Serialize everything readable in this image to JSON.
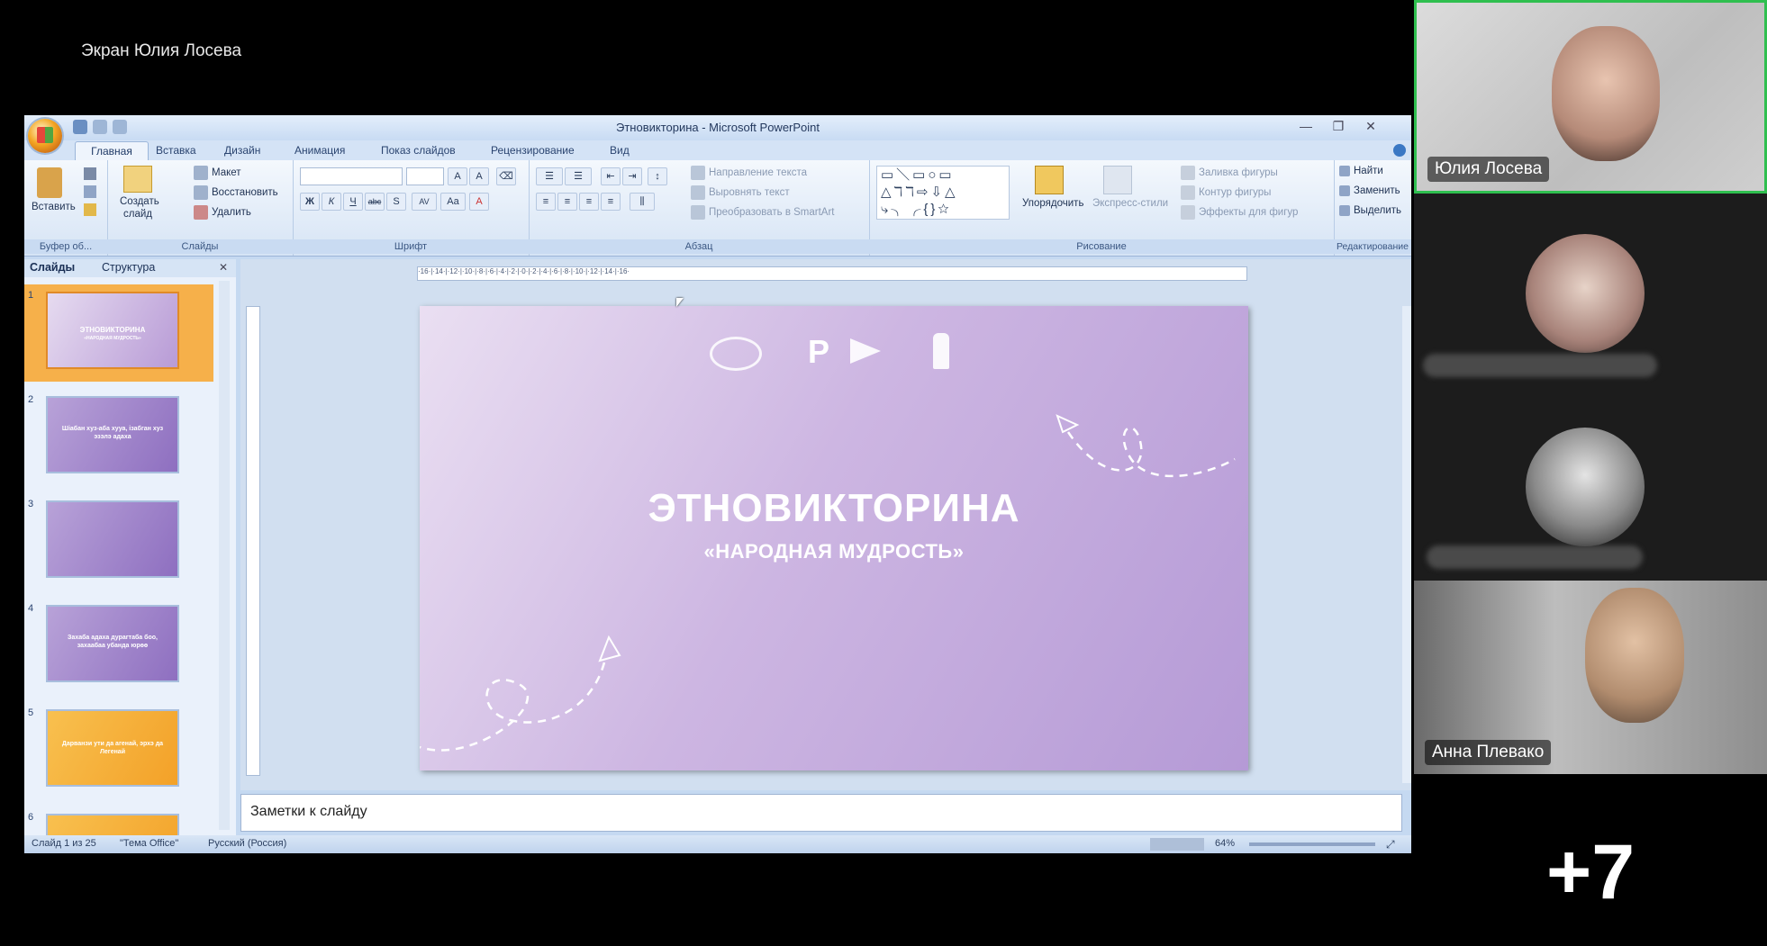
{
  "screen_share": {
    "label": "Экран Юлия Лосева"
  },
  "window": {
    "title": "Этновикторина - Microsoft PowerPoint",
    "tabs": [
      "Главная",
      "Вставка",
      "Дизайн",
      "Анимация",
      "Показ слайдов",
      "Рецензирование",
      "Вид"
    ]
  },
  "ribbon": {
    "clipboard": {
      "paste": "Вставить",
      "group": "Буфер об..."
    },
    "slides": {
      "new_slide_1": "Создать",
      "new_slide_2": "слайд",
      "layout": "Макет",
      "reset": "Восстановить",
      "delete": "Удалить",
      "group": "Слайды"
    },
    "font": {
      "group": "Шрифт",
      "bold": "Ж",
      "italic": "К",
      "underline": "Ч",
      "strike": "abc",
      "shadow": "S",
      "spacing": "AV",
      "case": "Aa",
      "color": "A"
    },
    "paragraph": {
      "text_direction": "Направление текста",
      "align_text": "Выровнять текст",
      "smartart": "Преобразовать в SmartArt",
      "group": "Абзац"
    },
    "drawing": {
      "arrange": "Упорядочить",
      "quick_styles": "Экспресс-стили",
      "fill": "Заливка фигуры",
      "outline": "Контур фигуры",
      "effects": "Эффекты для фигур",
      "group": "Рисование"
    },
    "editing": {
      "find": "Найти",
      "replace": "Заменить",
      "select": "Выделить",
      "group": "Редактирование"
    }
  },
  "panel": {
    "tab_slides": "Слайды",
    "tab_outline": "Структура",
    "thumbnails": [
      {
        "num": "1",
        "title": "ЭТНОВИКТОРИНА",
        "sub": "«НАРОДНАЯ МУДРОСТЬ»"
      },
      {
        "num": "2",
        "title": "Шіабан хуз-аба хууа, ізабган хуз эзэлэ адаха",
        "sub": ""
      },
      {
        "num": "3",
        "title": "",
        "sub": ""
      },
      {
        "num": "4",
        "title": "Захаба адаха дурагтаба боо, захаабаа убанда юрөө",
        "sub": ""
      },
      {
        "num": "5",
        "title": "Дарванзи ути да агенай, эрхэ да Легенай",
        "sub": ""
      },
      {
        "num": "6",
        "title": "",
        "sub": ""
      }
    ]
  },
  "ruler": {
    "ticks": "·16·|·14·|·12·|·10·|·8·|·6·|·4·|·2·|·0·|·2·|·4·|·6·|·8·|·10·|·12·|·14·|·16·"
  },
  "slide": {
    "title": "ЭТНОВИКТОРИНА",
    "subtitle": "«НАРОДНАЯ МУДРОСТЬ»"
  },
  "notes": {
    "placeholder": "Заметки к слайду"
  },
  "status": {
    "slide_count": "Слайд 1 из 25",
    "theme": "\"Тема Office\"",
    "language": "Русский (Россия)",
    "zoom": "64%"
  },
  "participants": [
    {
      "name": "Юлия Лосева",
      "active_speaker": true
    },
    {
      "name": "",
      "active_speaker": false
    },
    {
      "name": "",
      "active_speaker": false
    },
    {
      "name": "Анна Плевако",
      "active_speaker": false
    }
  ],
  "more_participants": "+7",
  "colors": {
    "active_speaker_border": "#2fbf4f",
    "slide_gradient_start": "#eadff2",
    "slide_gradient_end": "#b59ad6",
    "ribbon": "#d6e4f5"
  }
}
